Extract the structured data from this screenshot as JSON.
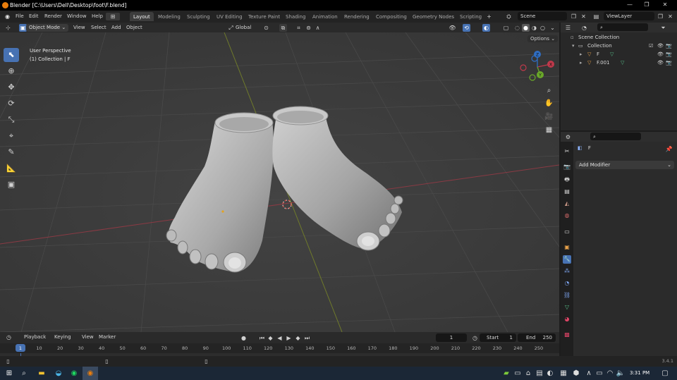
{
  "window": {
    "title": "Blender [C:\\Users\\Dell\\Desktop\\foot\\F.blend]"
  },
  "menu": {
    "file": "File",
    "edit": "Edit",
    "render": "Render",
    "window": "Window",
    "help": "Help"
  },
  "workspaces": [
    {
      "label": "Layout",
      "active": true
    },
    {
      "label": "Modeling"
    },
    {
      "label": "Sculpting"
    },
    {
      "label": "UV Editing"
    },
    {
      "label": "Texture Paint"
    },
    {
      "label": "Shading"
    },
    {
      "label": "Animation"
    },
    {
      "label": "Rendering"
    },
    {
      "label": "Compositing"
    },
    {
      "label": "Geometry Nodes"
    },
    {
      "label": "Scripting"
    }
  ],
  "scene": {
    "name": "Scene",
    "view_layer": "ViewLayer"
  },
  "viewport_header": {
    "mode": "Object Mode",
    "view": "View",
    "select": "Select",
    "add": "Add",
    "object": "Object",
    "transform_orientation": "Global",
    "options": "Options"
  },
  "viewport": {
    "perspective": "User Perspective",
    "collection_info": "(1) Collection | F",
    "gizmo": {
      "x": "X",
      "y": "Y",
      "z": "Z"
    }
  },
  "outliner": {
    "root": "Scene Collection",
    "collection": "Collection",
    "objects": [
      "F",
      "F.001"
    ]
  },
  "properties": {
    "object_name": "F",
    "add_modifier": "Add Modifier"
  },
  "timeline": {
    "playback": "Playback",
    "keying": "Keying",
    "view": "View",
    "marker": "Marker",
    "current_frame": "1",
    "start_label": "Start",
    "start": "1",
    "end_label": "End",
    "end": "250",
    "ticks": [
      "1",
      "10",
      "20",
      "30",
      "40",
      "50",
      "60",
      "70",
      "80",
      "90",
      "100",
      "110",
      "120",
      "130",
      "140",
      "150",
      "160",
      "170",
      "180",
      "190",
      "200",
      "210",
      "220",
      "230",
      "240",
      "250"
    ]
  },
  "statusbar": {
    "version": "3.4.1"
  },
  "taskbar": {
    "time": "3:31 PM"
  },
  "colors": {
    "accent": "#4772b3",
    "blender_orange": "#e87d0d",
    "x_axis": "#c0394b",
    "y_axis": "#6aa829",
    "z_axis": "#2f6ec4"
  }
}
